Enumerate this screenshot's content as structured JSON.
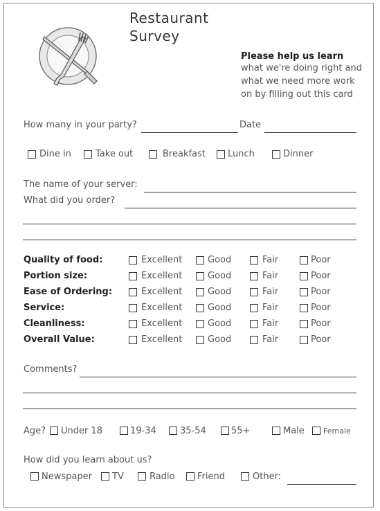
{
  "header": {
    "title_line1": "Restaurant",
    "title_line2": "Survey",
    "tagline_bold": "Please help us learn",
    "tagline_lines": [
      "what we're doing right and",
      "what we need more work",
      "on by filling out this card"
    ]
  },
  "party": {
    "label": "How many in your party?",
    "date_label": "Date"
  },
  "visit_type": {
    "options": [
      "Dine in",
      "Take out",
      "Breakfast",
      "Lunch",
      "Dinner"
    ]
  },
  "server": {
    "label": "The name of your server:"
  },
  "order": {
    "label": "What did you order?"
  },
  "ratings": {
    "scale": [
      "Excellent",
      "Good",
      "Fair",
      "Poor"
    ],
    "categories": [
      "Quality of food:",
      "Portion size:",
      "Ease of Ordering:",
      "Service:",
      "Cleanliness:",
      "Overall Value:"
    ]
  },
  "comments": {
    "label": "Comments?"
  },
  "age": {
    "label": "Age?",
    "options": [
      "Under 18",
      "19-34",
      "35-54",
      "55+"
    ],
    "gender": [
      "Male",
      "Female"
    ]
  },
  "source": {
    "question": "How did you learn about us?",
    "options": [
      "Newspaper",
      "TV",
      "Radio",
      "Friend",
      "Other:"
    ]
  }
}
